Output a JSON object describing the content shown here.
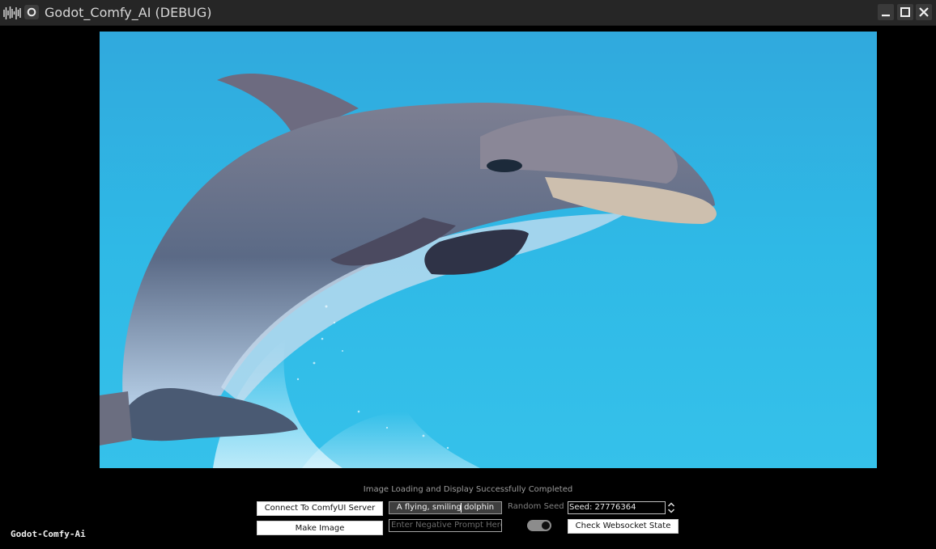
{
  "window": {
    "title": "Godot_Comfy_AI (DEBUG)"
  },
  "icons": {
    "app": "waveform-app-icon",
    "godot": "godot-logo-icon",
    "minimize": "minimize-icon",
    "maximize": "maximize-icon",
    "close": "close-icon",
    "spinner": "up-down-arrows-icon"
  },
  "colors": {
    "background": "#000000",
    "titlebar": "#262626",
    "image_water": "#2fb5e3"
  },
  "main": {
    "image_subject": "dolphin",
    "status": "Image Loading and Display Successfully Completed"
  },
  "controls": {
    "connect_label": "Connect To ComfyUI Server",
    "make_image_label": "Make Image",
    "prompt_value": "A flying, smiling dolphin",
    "negative_placeholder": "Enter Negative Prompt Here",
    "random_seed_label": "Random Seed",
    "random_seed_on": true,
    "seed_value": "Seed: 27776364",
    "check_label": "Check Websocket State"
  },
  "brand": {
    "text": "Godot-Comfy-Ai"
  }
}
